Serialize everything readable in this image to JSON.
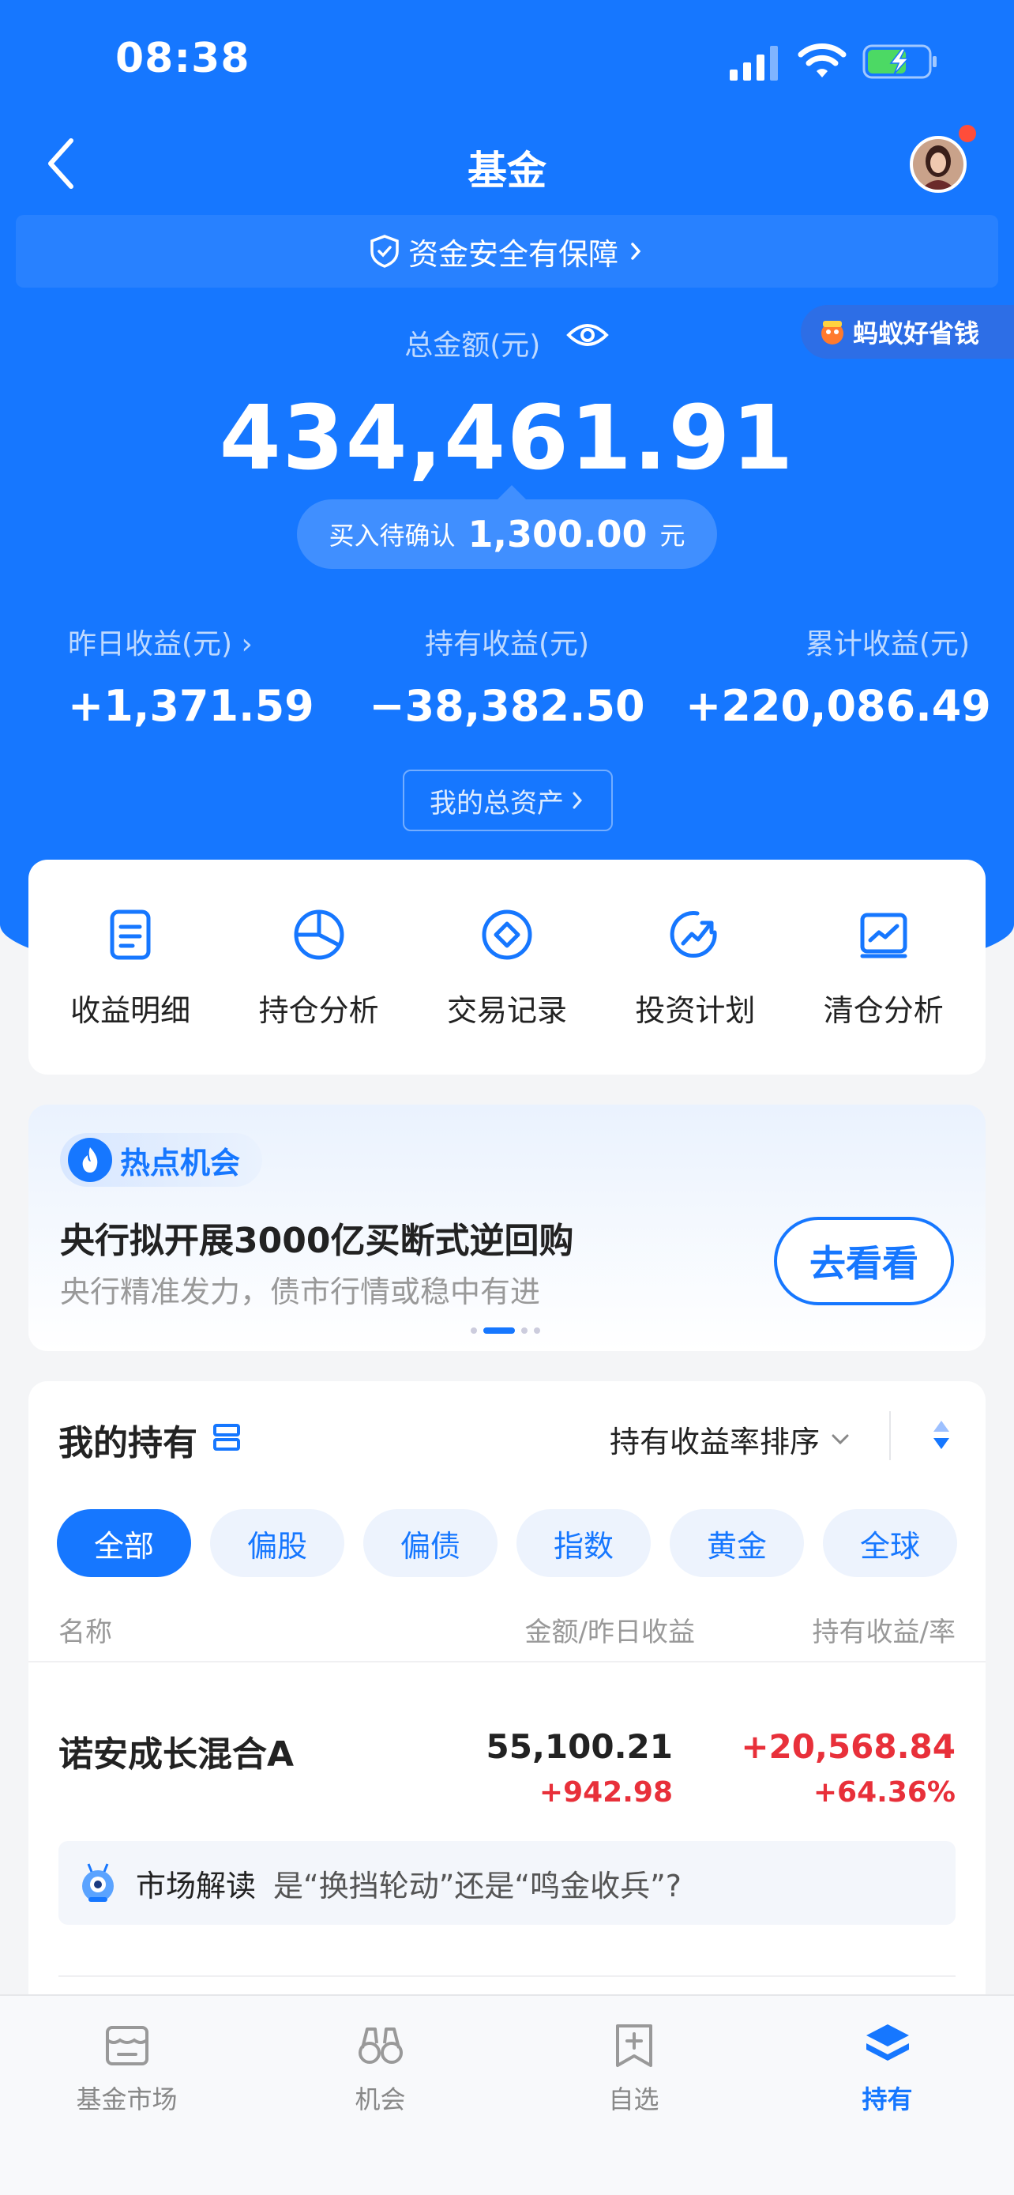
{
  "status_bar": {
    "time": "08:38"
  },
  "nav": {
    "title": "基金"
  },
  "safety_banner": {
    "text": "资金安全有保障"
  },
  "ad_tag": {
    "text": "蚂蚁好省钱"
  },
  "total": {
    "label": "总金额(元)",
    "amount": "434,461.91",
    "pending_label": "买入待确认",
    "pending_amount": "1,300.00",
    "pending_unit": "元"
  },
  "stats": [
    {
      "label": "昨日收益(元)",
      "value": "+1,371.59"
    },
    {
      "label": "持有收益(元)",
      "value": "−38,382.50"
    },
    {
      "label": "累计收益(元)",
      "value": "+220,086.49"
    }
  ],
  "my_assets_button": "我的总资产",
  "quick_actions": [
    {
      "label": "收益明细",
      "icon": "document-icon"
    },
    {
      "label": "持仓分析",
      "icon": "pie-chart-icon"
    },
    {
      "label": "交易记录",
      "icon": "diamond-circle-icon"
    },
    {
      "label": "投资计划",
      "icon": "trend-up-icon"
    },
    {
      "label": "清仓分析",
      "icon": "line-chart-icon"
    }
  ],
  "hot": {
    "tag": "热点机会",
    "title": "央行拟开展3000亿买断式逆回购",
    "subtitle": "央行精准发力，债市行情或稳中有进",
    "button": "去看看"
  },
  "holdings": {
    "title": "我的持有",
    "sort_label": "持有收益率排序",
    "chips": [
      "全部",
      "偏股",
      "偏债",
      "指数",
      "黄金",
      "全球"
    ],
    "active_chip": "全部",
    "columns": {
      "name": "名称",
      "amount": "金额/昨日收益",
      "profit": "持有收益/率"
    },
    "fund": {
      "name": "诺安成长混合A",
      "amount": "55,100.21",
      "yesterday": "+942.98",
      "profit": "+20,568.84",
      "rate": "+64.36%"
    },
    "insight": {
      "tag": "市场解读",
      "text": "是“换挡轮动”还是“鸣金收兵”?"
    }
  },
  "tabbar": [
    {
      "label": "基金市场",
      "icon": "market-icon"
    },
    {
      "label": "机会",
      "icon": "binoculars-icon"
    },
    {
      "label": "自选",
      "icon": "add-bookmark-icon"
    },
    {
      "label": "持有",
      "icon": "layers-icon"
    }
  ],
  "colors": {
    "primary": "#1677ff",
    "gain": "#e8303a"
  }
}
